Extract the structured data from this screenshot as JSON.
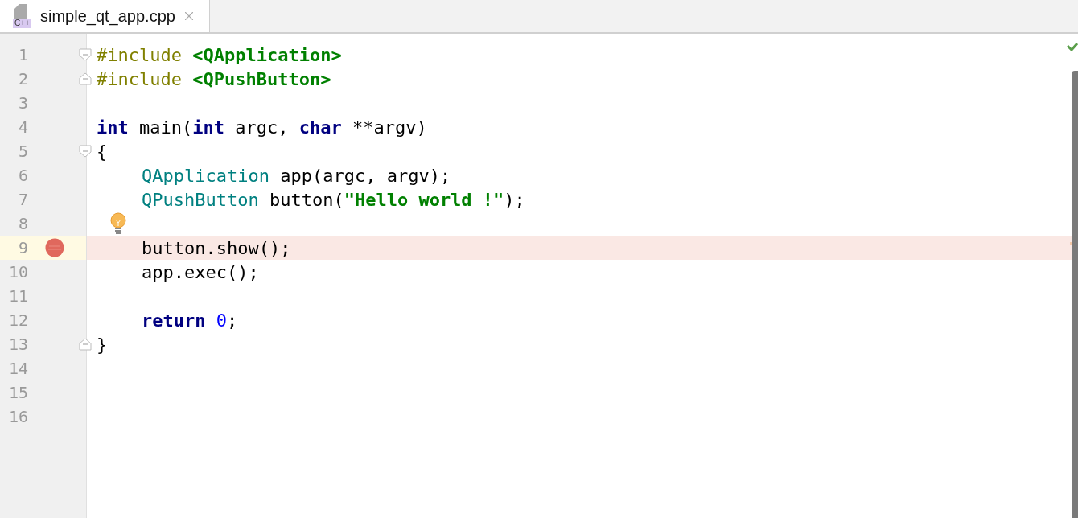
{
  "tab": {
    "icon_label": "C++",
    "title": "simple_qt_app.cpp",
    "selected": true
  },
  "lines": [
    {
      "number": "1",
      "indented": false,
      "fold_start": true,
      "fold_end": false,
      "breakpoint": false,
      "hint": false,
      "tokens": [
        {
          "kind": "directive",
          "text": "#include "
        },
        {
          "kind": "header",
          "text": "<QApplication>"
        }
      ]
    },
    {
      "number": "2",
      "indented": false,
      "fold_start": false,
      "fold_end": true,
      "breakpoint": false,
      "hint": false,
      "tokens": [
        {
          "kind": "directive",
          "text": "#include "
        },
        {
          "kind": "header",
          "text": "<QPushButton>"
        }
      ]
    },
    {
      "number": "3",
      "fold_start": false,
      "fold_end": false,
      "breakpoint": false,
      "hint": false
    },
    {
      "number": "4",
      "indented": false,
      "fold_start": false,
      "fold_end": false,
      "breakpoint": false,
      "hint": false,
      "tokens": [
        {
          "kind": "keyword",
          "text": "int"
        },
        {
          "kind": "plain",
          "text": " main("
        },
        {
          "kind": "keyword",
          "text": "int"
        },
        {
          "kind": "plain",
          "text": " argc, "
        },
        {
          "kind": "keyword",
          "text": "char"
        },
        {
          "kind": "plain",
          "text": " **argv)"
        }
      ]
    },
    {
      "number": "5",
      "indented": false,
      "fold_start": true,
      "fold_end": false,
      "breakpoint": false,
      "hint": false,
      "tokens": [
        {
          "kind": "plain",
          "text": "{"
        }
      ]
    },
    {
      "number": "6",
      "indented": true,
      "fold_start": false,
      "fold_end": false,
      "breakpoint": false,
      "hint": false,
      "tokens": [
        {
          "kind": "type",
          "text": "QApplication"
        },
        {
          "kind": "plain",
          "text": " app(argc, argv);"
        }
      ]
    },
    {
      "number": "7",
      "indented": true,
      "fold_start": false,
      "fold_end": false,
      "breakpoint": false,
      "hint": false,
      "tokens": [
        {
          "kind": "type",
          "text": "QPushButton"
        },
        {
          "kind": "plain",
          "text": " button("
        },
        {
          "kind": "string",
          "text": "\"Hello world !\""
        },
        {
          "kind": "plain",
          "text": ");"
        }
      ]
    },
    {
      "number": "8",
      "fold_start": false,
      "fold_end": false,
      "breakpoint": false,
      "hint": true
    },
    {
      "number": "9",
      "indented": true,
      "fold_start": false,
      "fold_end": false,
      "breakpoint": true,
      "hint": false,
      "tokens": [
        {
          "kind": "plain",
          "text": "button.show();"
        }
      ]
    },
    {
      "number": "10",
      "indented": true,
      "fold_start": false,
      "fold_end": false,
      "breakpoint": false,
      "hint": false,
      "tokens": [
        {
          "kind": "plain",
          "text": "app.exec();"
        }
      ]
    },
    {
      "number": "11",
      "fold_start": false,
      "fold_end": false,
      "breakpoint": false,
      "hint": false
    },
    {
      "number": "12",
      "indented": true,
      "fold_start": false,
      "fold_end": false,
      "breakpoint": false,
      "hint": false,
      "tokens": [
        {
          "kind": "keyword",
          "text": "return "
        },
        {
          "kind": "number",
          "text": "0"
        },
        {
          "kind": "plain",
          "text": ";"
        }
      ]
    },
    {
      "number": "13",
      "indented": false,
      "fold_start": false,
      "fold_end": true,
      "breakpoint": false,
      "hint": false,
      "tokens": [
        {
          "kind": "plain",
          "text": "}"
        }
      ]
    },
    {
      "number": "14",
      "fold_start": false,
      "fold_end": false,
      "breakpoint": false,
      "hint": false
    },
    {
      "number": "15",
      "fold_start": false,
      "fold_end": false,
      "breakpoint": false,
      "hint": false
    },
    {
      "number": "16",
      "fold_start": false,
      "fold_end": false,
      "breakpoint": false,
      "hint": false
    }
  ]
}
